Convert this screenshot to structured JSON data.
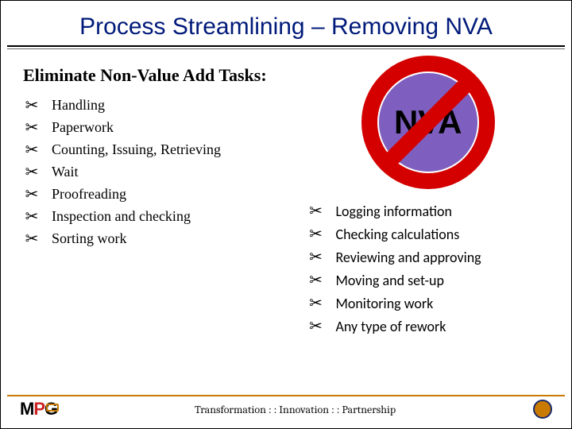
{
  "title": "Process Streamlining – Removing NVA",
  "subtitle": "Eliminate Non-Value Add Tasks:",
  "nva_label": "NVA",
  "left_items": {
    "i0": "Handling",
    "i1": "Paperwork",
    "i2": "Counting, Issuing, Retrieving",
    "i3": "Wait",
    "i4": "Proofreading",
    "i5": "Inspection and checking",
    "i6": "Sorting work"
  },
  "right_items": {
    "i0": "Logging information",
    "i1": "Checking calculations",
    "i2": "Reviewing and approving",
    "i3": "Moving and set-up",
    "i4": "Monitoring work",
    "i5": "Any type of rework"
  },
  "footer": "Transformation : : Innovation : : Partnership",
  "logo": {
    "m": "M",
    "p": "P",
    "g": "G"
  },
  "scissor_glyph": "✂"
}
